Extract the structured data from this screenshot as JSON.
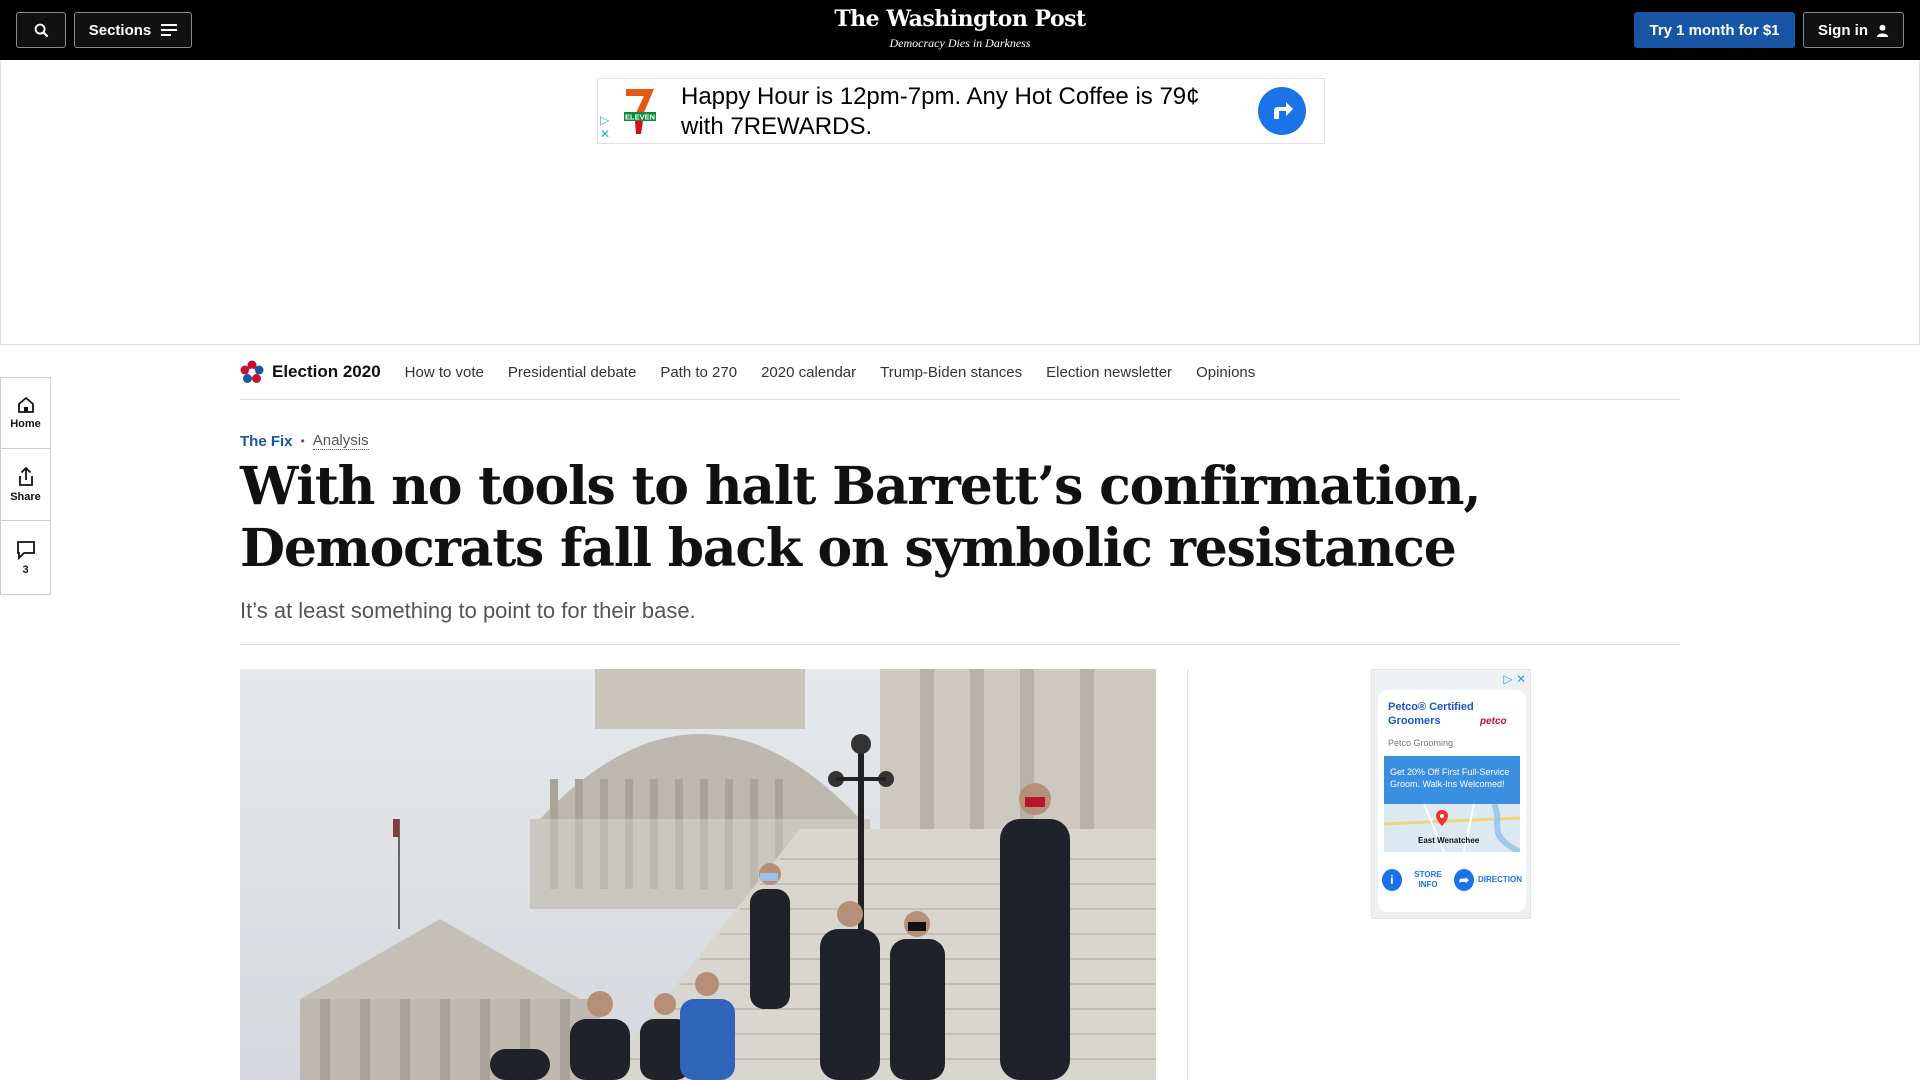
{
  "topbar": {
    "sections_label": "Sections",
    "logo": "The Washington Post",
    "tagline": "Democracy Dies in Darkness",
    "subscribe_label": "Try 1 month for $1",
    "signin_label": "Sign in"
  },
  "top_ad": {
    "brand_text": "ELEVEN",
    "line1": "Happy Hour is 12pm-7pm. Any Hot Coffee is 79¢",
    "line2": "with 7REWARDS."
  },
  "rail": {
    "home_label": "Home",
    "share_label": "Share",
    "comments_count": "3"
  },
  "election_nav": {
    "brand": "Election 2020",
    "links": [
      "How to vote",
      "Presidential debate",
      "Path to 270",
      "2020 calendar",
      "Trump-Biden stances",
      "Election newsletter",
      "Opinions"
    ]
  },
  "article": {
    "section": "The Fix",
    "separator": "•",
    "label": "Analysis",
    "headline": "With no tools to halt Barrett’s confirmation, Democrats fall back on symbolic resistance",
    "dek": "It’s at least something to point to for their base."
  },
  "side_ad": {
    "title": "Petco® Certified Groomers",
    "brand": "petco",
    "subtitle": "Petco Grooming",
    "promo": "Get 20% Off First Full-Service Groom. Walk-Ins Welcomed!",
    "map_label": "East Wenatchee",
    "store_info": "STORE INFO",
    "directions": "DIRECTION"
  },
  "colors": {
    "accent_blue": "#1955a5",
    "topbar_bg": "#000000"
  }
}
